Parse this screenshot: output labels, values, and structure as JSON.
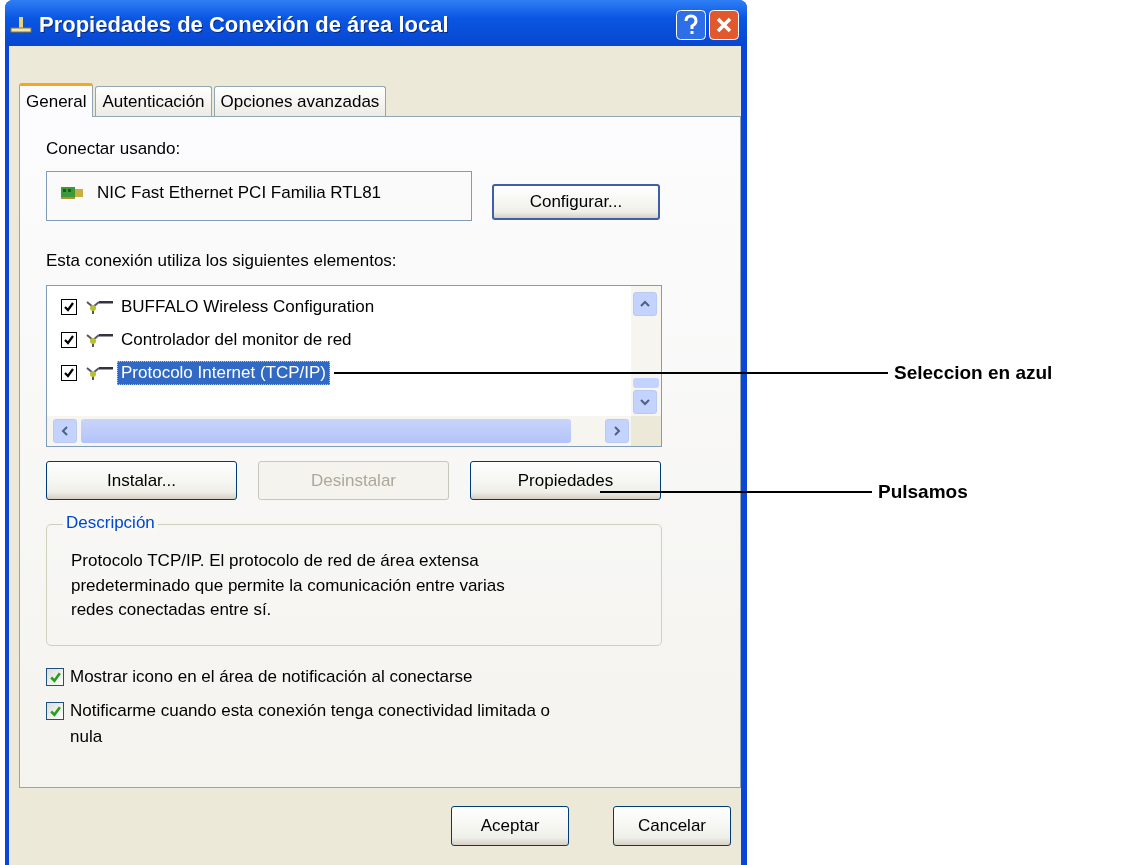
{
  "window": {
    "title": "Propiedades de Conexión de área local"
  },
  "tabs": [
    {
      "label": "General",
      "selected": true
    },
    {
      "label": "Autenticación",
      "selected": false
    },
    {
      "label": "Opciones avanzadas",
      "selected": false
    }
  ],
  "connect_using": {
    "label": "Conectar usando:",
    "device": "NIC Fast Ethernet PCI Familia RTL81",
    "button": "Configurar..."
  },
  "components": {
    "label": "Esta conexión utiliza los siguientes elementos:",
    "items": [
      {
        "label": "BUFFALO Wireless Configuration",
        "checked": true,
        "selected": false
      },
      {
        "label": "Controlador del monitor de red",
        "checked": true,
        "selected": false
      },
      {
        "label": "Protocolo Internet (TCP/IP)",
        "checked": true,
        "selected": true
      }
    ]
  },
  "buttons": [
    {
      "label": "Instalar...",
      "disabled": false
    },
    {
      "label": "Desinstalar",
      "disabled": true
    },
    {
      "label": "Propiedades",
      "disabled": false
    }
  ],
  "description": {
    "legend": "Descripción",
    "text": "Protocolo TCP/IP. El protocolo de red de área extensa predeterminado que permite la comunicación entre varias redes conectadas entre sí."
  },
  "options": [
    {
      "label": "Mostrar icono en el área de notificación al conectarse",
      "checked": true
    },
    {
      "label": "Notificarme cuando esta conexión tenga conectividad limitada o nula",
      "checked": true
    }
  ],
  "footer_buttons": [
    "Aceptar",
    "Cancelar"
  ],
  "annotations": [
    "Seleccion en azul",
    "Pulsamos"
  ]
}
